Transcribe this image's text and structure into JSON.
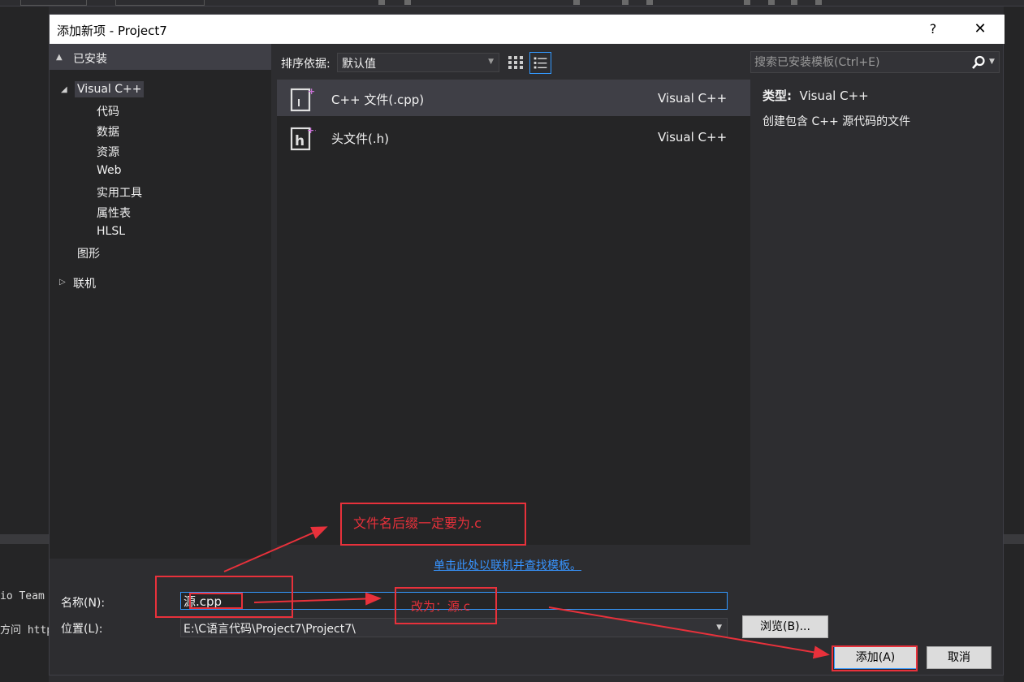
{
  "background_ide": {
    "output_lines": [
      "io Team",
      "方问 http"
    ]
  },
  "dialog": {
    "title": "添加新项 - Project7",
    "help_label": "?",
    "close_label": "✕"
  },
  "tree": {
    "header": "已安装",
    "root": "Visual C++",
    "children": [
      "代码",
      "数据",
      "资源",
      "Web",
      "实用工具",
      "属性表",
      "HLSL"
    ],
    "graphics": "图形",
    "online": "联机"
  },
  "sortbar": {
    "label": "排序依据:",
    "value": "默认值"
  },
  "templates": [
    {
      "name": "C++ 文件(.cpp)",
      "lang": "Visual C++",
      "icon": "cpp-file-icon",
      "selected": true
    },
    {
      "name": "头文件(.h)",
      "lang": "Visual C++",
      "icon": "header-file-icon",
      "selected": false
    }
  ],
  "online_link": "单击此处以联机并查找模板。",
  "search": {
    "placeholder": "搜索已安装模板(Ctrl+E)"
  },
  "info": {
    "type_key": "类型:",
    "type_value": "Visual C++",
    "description": "创建包含 C++ 源代码的文件"
  },
  "form": {
    "name_label": "名称(N):",
    "name_value": "源.cpp",
    "location_label": "位置(L):",
    "location_value": "E:\\C语言代码\\Project7\\Project7\\",
    "browse_label": "浏览(B)...",
    "add_label": "添加(A)",
    "cancel_label": "取消"
  },
  "annotations": {
    "suffix_note": "文件名后缀一定要为.c",
    "rename_note": "改为：源.c",
    "color": "#e8313b"
  },
  "colors": {
    "dialog_bg": "#2d2d30",
    "panel_bg": "#252526",
    "selection": "#3f3f46",
    "accent": "#3399ff",
    "link": "#3794ff"
  }
}
